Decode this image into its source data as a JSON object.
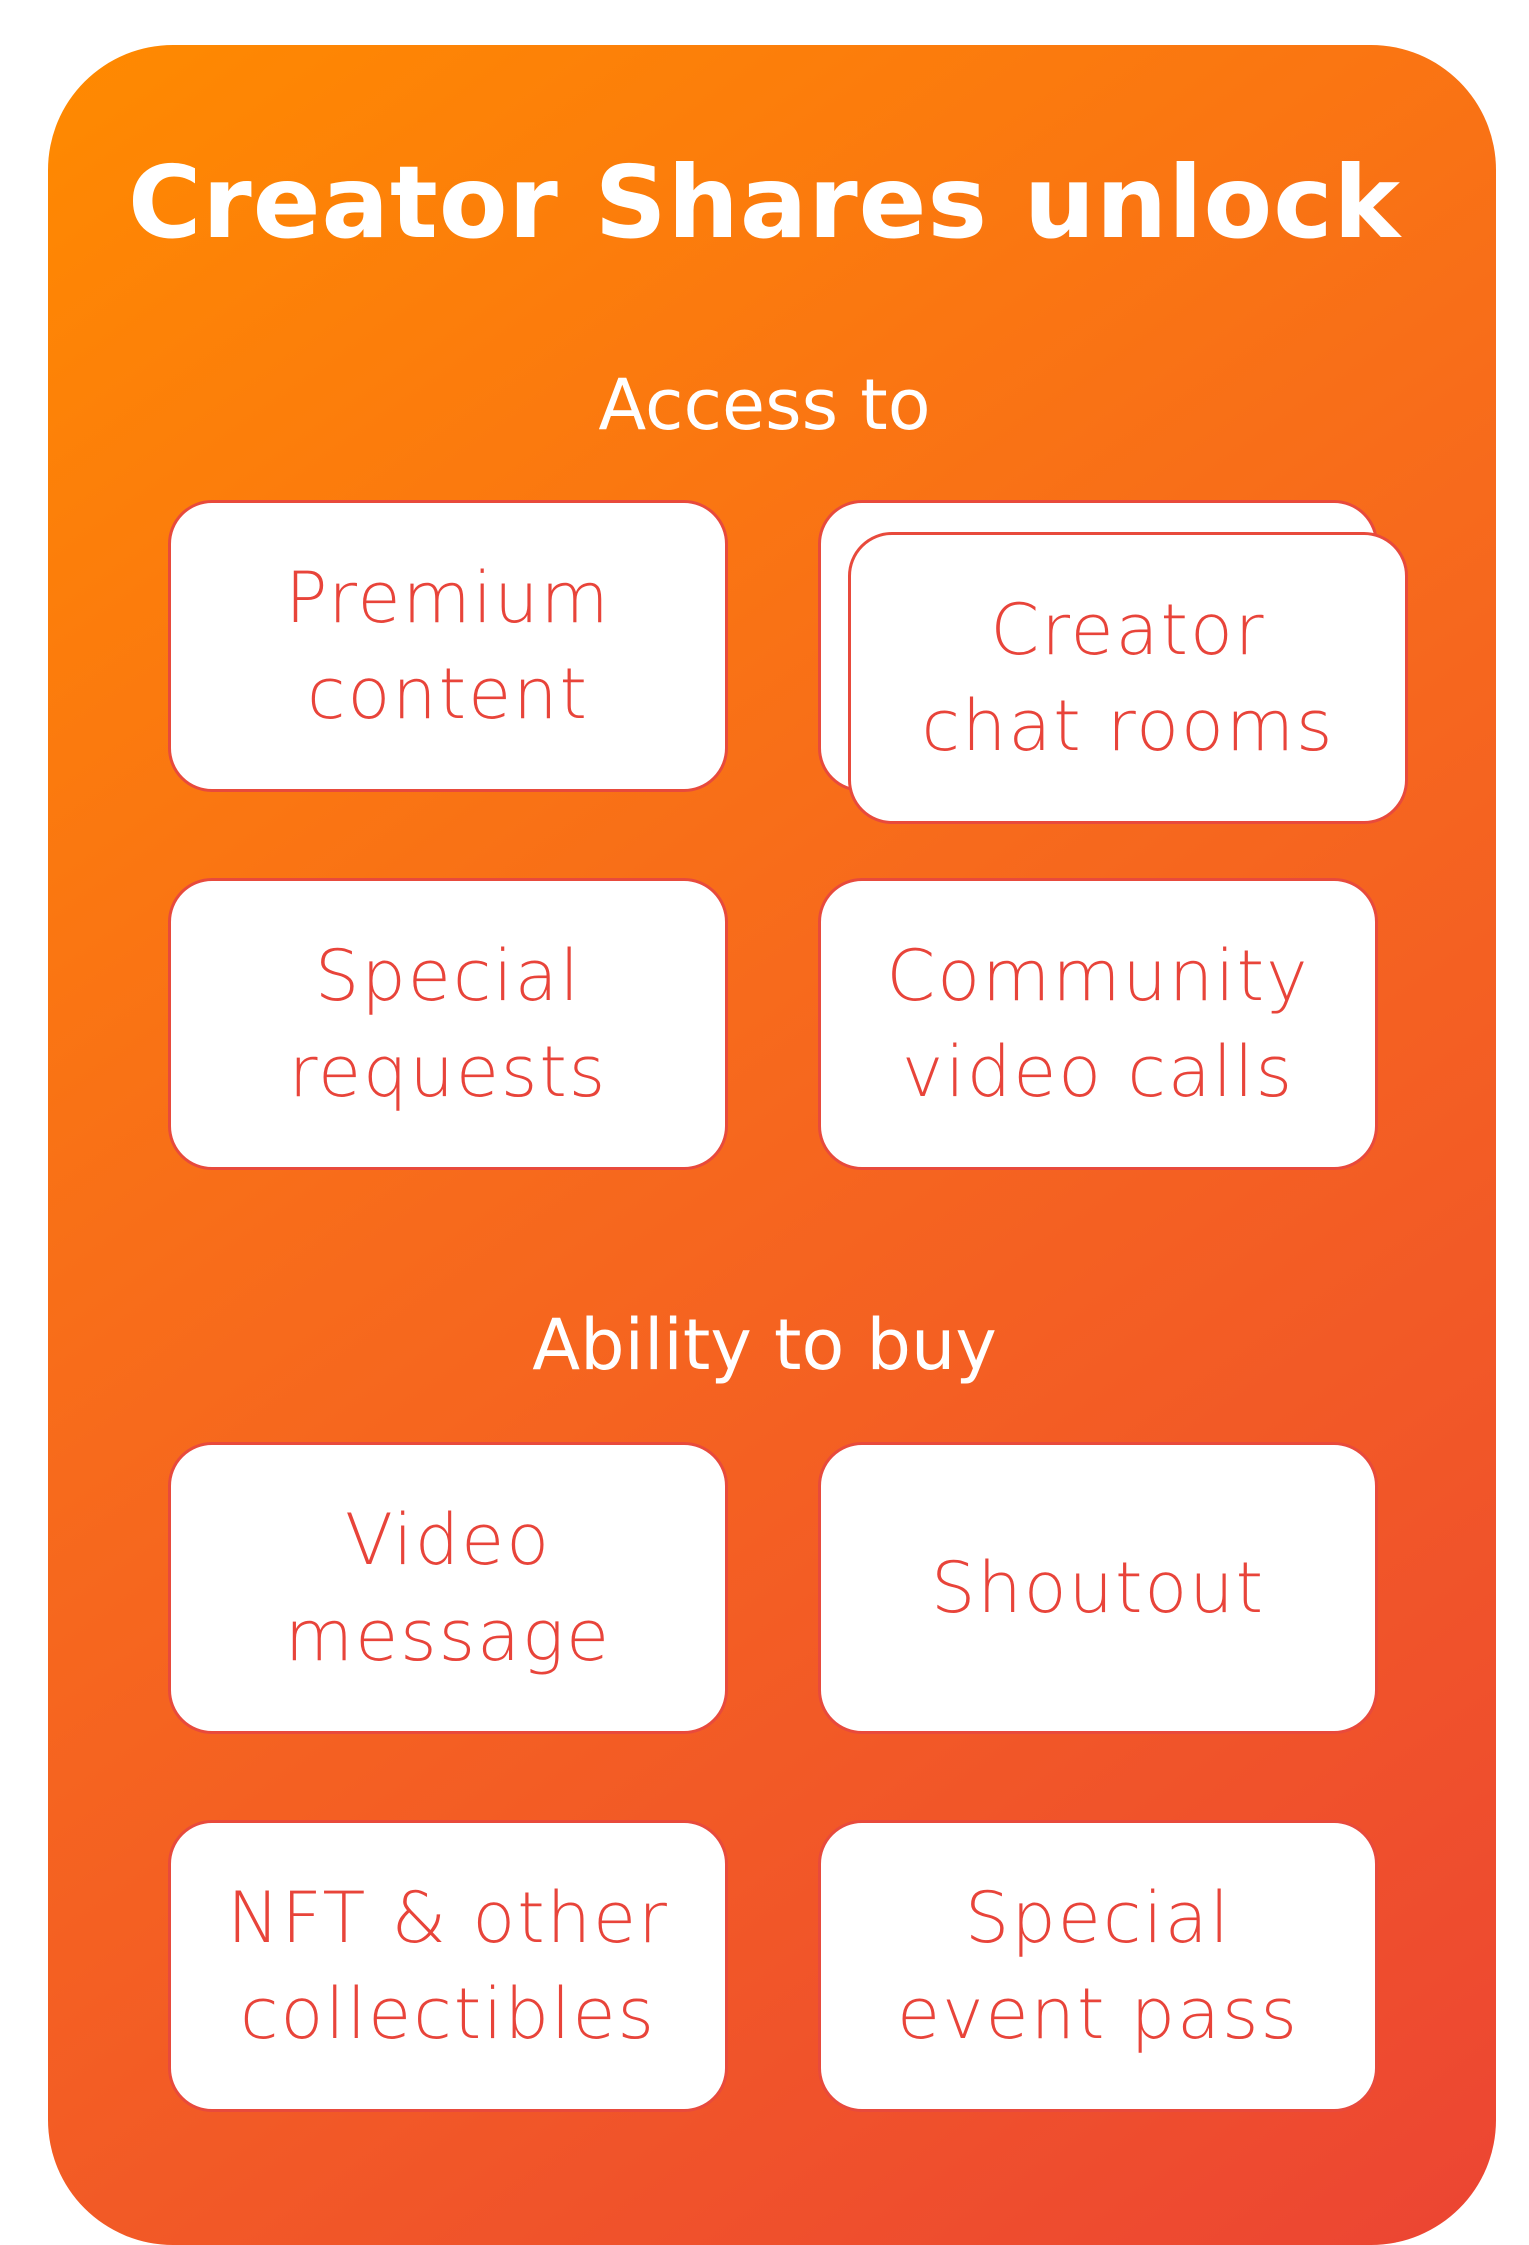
{
  "title": "Creator Shares unlock",
  "sections": [
    {
      "heading": "Access to",
      "cards": [
        {
          "lines": [
            "Premium",
            "content"
          ]
        },
        {
          "lines": [
            "Creator",
            "chat rooms"
          ]
        },
        {
          "lines": [
            "Special",
            "requests"
          ]
        },
        {
          "lines": [
            "Community",
            "video calls"
          ]
        }
      ]
    },
    {
      "heading": "Ability to buy",
      "cards": [
        {
          "lines": [
            "Video",
            "message"
          ]
        },
        {
          "lines": [
            "Shoutout"
          ]
        },
        {
          "lines": [
            "NFT & other",
            "collectibles"
          ]
        },
        {
          "lines": [
            "Special",
            "event pass"
          ]
        }
      ]
    }
  ],
  "colors": {
    "gradient_start": "#ff8a00",
    "gradient_end": "#ec4533",
    "card_text": "#e8443a",
    "card_border": "#e84a3c",
    "heading_text": "#ffffff"
  }
}
